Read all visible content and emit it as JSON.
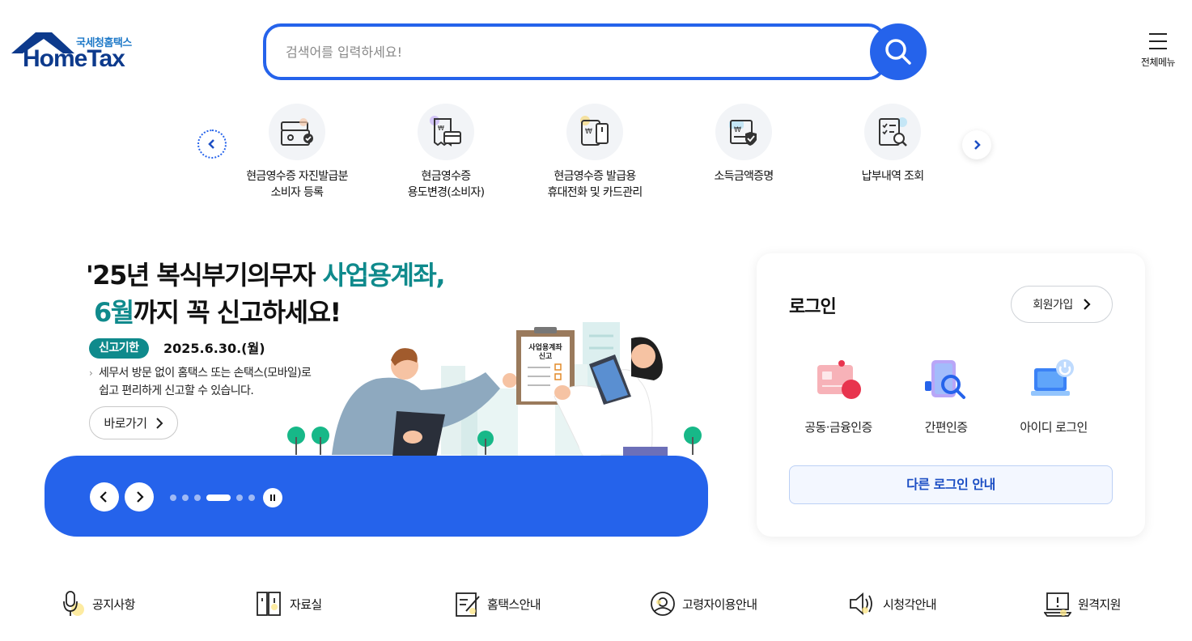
{
  "header": {
    "logo_sub": "국세청홈택스",
    "logo_main": "HomeTax",
    "search_placeholder": "검색어를 입력하세요!",
    "menu_label": "전체메뉴"
  },
  "quick_menu": {
    "items": [
      {
        "line1": "현금영수증 자진발급분",
        "line2": "소비자 등록",
        "icon": "receipt-register-icon"
      },
      {
        "line1": "현금영수증",
        "line2": "용도변경(소비자)",
        "icon": "receipt-change-icon"
      },
      {
        "line1": "현금영수증 발급용",
        "line2": "휴대전화 및 카드관리",
        "icon": "phone-card-icon"
      },
      {
        "line1": "소득금액증명",
        "line2": "",
        "icon": "income-certificate-icon"
      },
      {
        "line1": "납부내역 조회",
        "line2": "",
        "icon": "payment-history-icon"
      }
    ]
  },
  "banner": {
    "title_part1": "'25년 복식부기의무자 ",
    "title_highlight1": "사업용계좌,",
    "title_highlight2": "6월",
    "title_part2": "까지 꼭 신고하세요!",
    "badge": "신고기한",
    "date": "2025.6.30.(월)",
    "desc_line1": "세무서 방문 없이 홈택스 또는 손택스(모바일)로",
    "desc_line2": "쉽고 편리하게 신고할 수 있습니다.",
    "goto_label": "바로가기",
    "clipboard_line1": "사업용계좌",
    "clipboard_line2": "신고",
    "slide_count": 6,
    "active_slide": 4,
    "accent_color": "#0f8a8c",
    "bar_color": "#2563eb"
  },
  "login": {
    "title": "로그인",
    "join_label": "회원가입",
    "options": [
      {
        "label": "공동·금융인증",
        "icon": "certificate-icon"
      },
      {
        "label": "간편인증",
        "icon": "simple-auth-icon"
      },
      {
        "label": "아이디 로그인",
        "icon": "id-login-icon"
      }
    ],
    "other_login": "다른 로그인 안내"
  },
  "bottom_links": [
    {
      "label": "공지사항",
      "icon": "microphone-icon"
    },
    {
      "label": "자료실",
      "icon": "archive-icon"
    },
    {
      "label": "홈택스안내",
      "icon": "guide-icon"
    },
    {
      "label": "고령자이용안내",
      "icon": "senior-icon"
    },
    {
      "label": "시청각안내",
      "icon": "speaker-icon"
    },
    {
      "label": "원격지원",
      "icon": "remote-support-icon"
    }
  ]
}
